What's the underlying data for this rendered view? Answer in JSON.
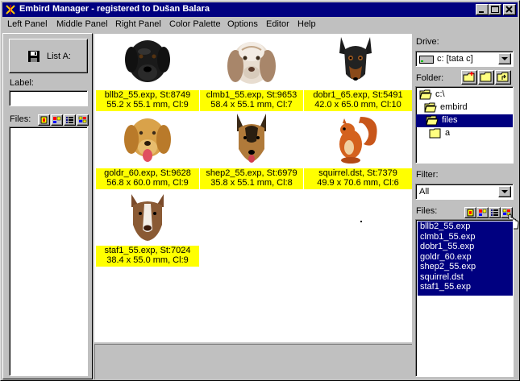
{
  "window": {
    "title": "Embird Manager - registered to Dušan Balara"
  },
  "menu": [
    {
      "label": "Left Panel"
    },
    {
      "label": "Middle Panel"
    },
    {
      "label": "Right Panel"
    },
    {
      "label": "Color Palette"
    },
    {
      "label": "Options"
    },
    {
      "label": "Editor"
    },
    {
      "label": "Help"
    }
  ],
  "left_panel": {
    "list_button_label": "List A:",
    "label_caption": "Label:",
    "label_value": "",
    "files_caption": "Files:"
  },
  "thumbnails": [
    {
      "line1": "bllb2_55.exp, St:8749",
      "line2": "55.2 x 55.1 mm, Cl:9",
      "icon": "black-labrador-icon"
    },
    {
      "line1": "clmb1_55.exp, St:9653",
      "line2": "58.4 x 55.1 mm, Cl:7",
      "icon": "clumber-spaniel-icon"
    },
    {
      "line1": "dobr1_65.exp, St:5491",
      "line2": "42.0 x 65.0 mm, Cl:10",
      "icon": "doberman-icon"
    },
    {
      "line1": "goldr_60.exp, St:9628",
      "line2": "56.8 x 60.0 mm, Cl:9",
      "icon": "golden-retriever-icon"
    },
    {
      "line1": "shep2_55.exp, St:6979",
      "line2": "35.8 x 55.1 mm, Cl:8",
      "icon": "german-shepherd-icon"
    },
    {
      "line1": "squirrel.dst, St:7379",
      "line2": "49.9 x 70.6 mm, Cl:6",
      "icon": "squirrel-icon"
    },
    {
      "line1": "staf1_55.exp, St:7024",
      "line2": "38.4 x 55.0 mm, Cl:9",
      "icon": "staffordshire-terrier-icon"
    }
  ],
  "right_panel": {
    "drive_caption": "Drive:",
    "drive_value": "c: [tata c]",
    "folder_caption": "Folder:",
    "folders": [
      {
        "label": "c:\\",
        "selected": false
      },
      {
        "label": "embird",
        "selected": false
      },
      {
        "label": "files",
        "selected": true
      },
      {
        "label": "a",
        "selected": false
      }
    ],
    "filter_caption": "Filter:",
    "filter_value": "All",
    "files_caption": "Files:",
    "files": [
      "bllb2_55.exp",
      "clmb1_55.exp",
      "dobr1_55.exp",
      "goldr_60.exp",
      "shep2_55.exp",
      "squirrel.dst",
      "staf1_55.exp"
    ]
  },
  "colors": {
    "title_bar": "#000080",
    "selection": "#000080",
    "caption_highlight": "#ffff00",
    "face": "#c0c0c0"
  }
}
